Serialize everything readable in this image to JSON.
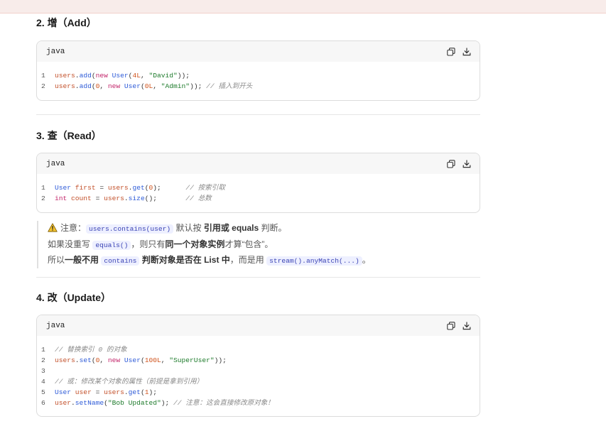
{
  "sections": {
    "add": {
      "heading": "2. 增（Add）",
      "lang": "java",
      "lines": [
        {
          "n": "1",
          "parts": [
            [
              "t-var",
              "users"
            ],
            [
              "t-p",
              "."
            ],
            [
              "t-fn",
              "add"
            ],
            [
              "t-p",
              "("
            ],
            [
              "t-kw",
              "new "
            ],
            [
              "t-type",
              "User"
            ],
            [
              "t-p",
              "("
            ],
            [
              "t-num",
              "4L"
            ],
            [
              "t-p",
              ", "
            ],
            [
              "t-str",
              "\"David\""
            ],
            [
              "t-p",
              "));"
            ]
          ]
        },
        {
          "n": "2",
          "parts": [
            [
              "t-var",
              "users"
            ],
            [
              "t-p",
              "."
            ],
            [
              "t-fn",
              "add"
            ],
            [
              "t-p",
              "("
            ],
            [
              "t-num",
              "0"
            ],
            [
              "t-p",
              ", "
            ],
            [
              "t-kw",
              "new "
            ],
            [
              "t-type",
              "User"
            ],
            [
              "t-p",
              "("
            ],
            [
              "t-num",
              "0L"
            ],
            [
              "t-p",
              ", "
            ],
            [
              "t-str",
              "\"Admin\""
            ],
            [
              "t-p",
              "));"
            ],
            [
              "t-cm",
              " // 插入到开头"
            ]
          ]
        }
      ]
    },
    "read": {
      "heading": "3. 查（Read）",
      "lang": "java",
      "lines": [
        {
          "n": "1",
          "parts": [
            [
              "t-type",
              "User "
            ],
            [
              "t-var",
              "first"
            ],
            [
              "t-p",
              " = "
            ],
            [
              "t-var",
              "users"
            ],
            [
              "t-p",
              "."
            ],
            [
              "t-fn",
              "get"
            ],
            [
              "t-p",
              "("
            ],
            [
              "t-num",
              "0"
            ],
            [
              "t-p",
              ");"
            ],
            [
              "t-p",
              "      "
            ],
            [
              "t-cm",
              "// 按索引取"
            ]
          ]
        },
        {
          "n": "2",
          "parts": [
            [
              "t-kw",
              "int "
            ],
            [
              "t-var",
              "count"
            ],
            [
              "t-p",
              " = "
            ],
            [
              "t-var",
              "users"
            ],
            [
              "t-p",
              "."
            ],
            [
              "t-fn",
              "size"
            ],
            [
              "t-p",
              "();"
            ],
            [
              "t-p",
              "       "
            ],
            [
              "t-cm",
              "// 总数"
            ]
          ]
        }
      ]
    },
    "note": {
      "line1_pre": "注意：",
      "line1_chip": "users.contains(user)",
      "line1_mid": " 默认按 ",
      "line1_bold": "引用或 equals",
      "line1_post": " 判断。",
      "line2_pre": "如果没重写 ",
      "line2_chip": "equals()",
      "line2_mid": "，则只有",
      "line2_bold": "同一个对象实例",
      "line2_post": "才算“包含”。",
      "line3_pre": "所以",
      "line3_bold1": "一般不用",
      "line3_chip1": "contains",
      "line3_bold2": " 判断对象是否在 List 中",
      "line3_mid": "，而是用 ",
      "line3_chip2": "stream().anyMatch(...)",
      "line3_post": "。"
    },
    "update": {
      "heading": "4. 改（Update）",
      "lang": "java",
      "lines": [
        {
          "n": "1",
          "parts": [
            [
              "t-cm",
              "// 替换索引 0 的对象"
            ]
          ]
        },
        {
          "n": "2",
          "parts": [
            [
              "t-var",
              "users"
            ],
            [
              "t-p",
              "."
            ],
            [
              "t-fn",
              "set"
            ],
            [
              "t-p",
              "("
            ],
            [
              "t-num",
              "0"
            ],
            [
              "t-p",
              ", "
            ],
            [
              "t-kw",
              "new "
            ],
            [
              "t-type",
              "User"
            ],
            [
              "t-p",
              "("
            ],
            [
              "t-num",
              "100L"
            ],
            [
              "t-p",
              ", "
            ],
            [
              "t-str",
              "\"SuperUser\""
            ],
            [
              "t-p",
              "));"
            ]
          ]
        },
        {
          "n": "3",
          "parts": []
        },
        {
          "n": "4",
          "parts": [
            [
              "t-cm",
              "// 或：修改某个对象的属性（前提是拿到引用）"
            ]
          ]
        },
        {
          "n": "5",
          "parts": [
            [
              "t-type",
              "User "
            ],
            [
              "t-var",
              "user"
            ],
            [
              "t-p",
              " = "
            ],
            [
              "t-var",
              "users"
            ],
            [
              "t-p",
              "."
            ],
            [
              "t-fn",
              "get"
            ],
            [
              "t-p",
              "("
            ],
            [
              "t-num",
              "1"
            ],
            [
              "t-p",
              ");"
            ]
          ]
        },
        {
          "n": "6",
          "parts": [
            [
              "t-var",
              "user"
            ],
            [
              "t-p",
              "."
            ],
            [
              "t-fn",
              "setName"
            ],
            [
              "t-p",
              "("
            ],
            [
              "t-str",
              "\"Bob Updated\""
            ],
            [
              "t-p",
              ");"
            ],
            [
              "t-cm",
              " // 注意：这会直接修改原对象！"
            ]
          ]
        }
      ]
    }
  },
  "icons": {
    "copy": "copy-icon",
    "download": "download-icon",
    "warning": "warning-icon"
  }
}
